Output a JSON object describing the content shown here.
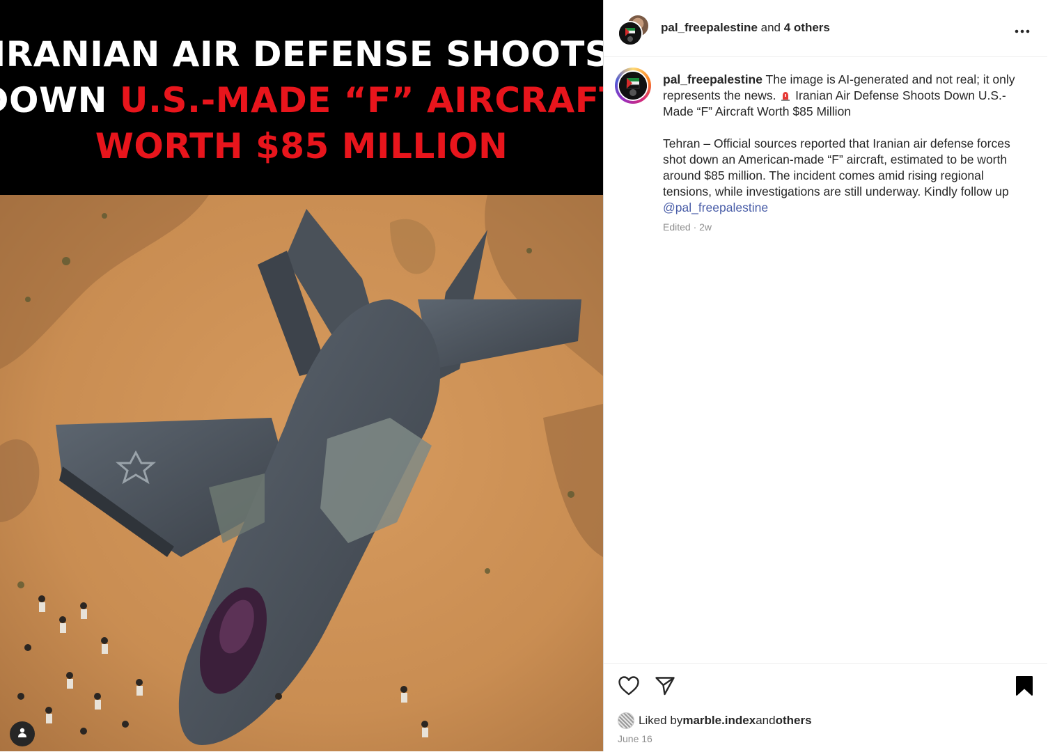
{
  "media": {
    "headline": {
      "line1": "IRANIAN AIR DEFENSE SHOOTS",
      "line2_white": "DOWN ",
      "line2_red": "U.S.-MADE “F” AIRCRAFT",
      "line3_red": "WORTH $85 MILLION"
    },
    "colors": {
      "headline_white": "#ffffff",
      "headline_red": "#e8151c",
      "background": "#000000",
      "sand": "#c98d52"
    },
    "tag_button_icon": "user-icon"
  },
  "post_header": {
    "username": "pal_freepalestine",
    "joiner": " and ",
    "others": "4 others",
    "more_icon": "more-dots-icon"
  },
  "caption": {
    "username": "pal_freepalestine",
    "text1": " The image is AI-generated and not real; it only represents the news. ",
    "emoji_icon": "siren-icon",
    "text2": " Iranian Air Defense Shoots Down U.S.-Made “F” Aircraft Worth $85 Million",
    "para2": "Tehran – Official sources reported that Iranian air defense forces shot down an American-made “F” aircraft, estimated to be worth around $85 million. The incident comes amid rising regional tensions, while investigations are still underway. Kindly follow up ",
    "mention": "@pal_freepalestine",
    "meta": "Edited · 2w"
  },
  "actions": {
    "like_icon": "heart-icon",
    "share_icon": "send-icon",
    "save_icon": "bookmark-icon",
    "liked_prefix": "Liked by ",
    "liked_user": "marble.index",
    "liked_joiner": " and ",
    "liked_others": "others",
    "date": "June 16"
  }
}
